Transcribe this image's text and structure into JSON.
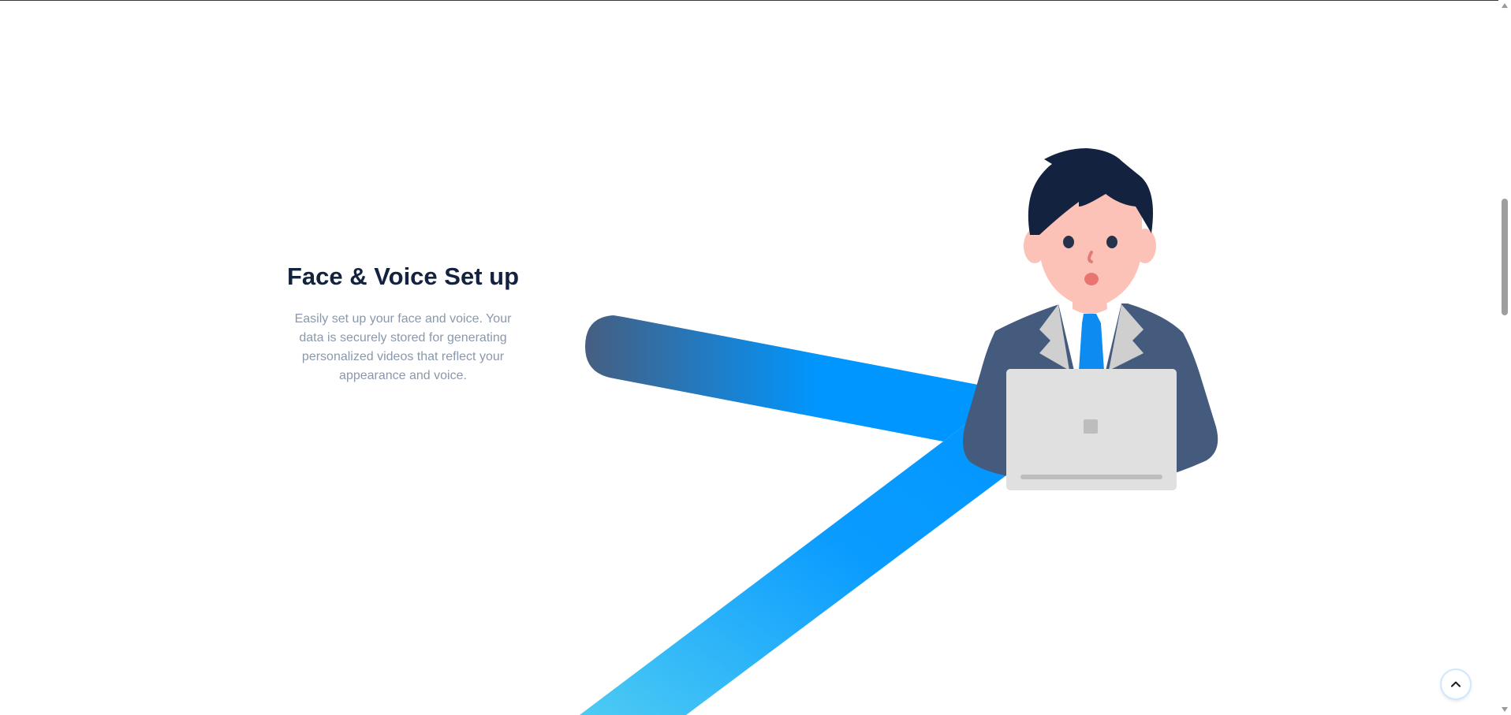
{
  "feature": {
    "title": "Face & Voice Set up",
    "description": "Easily set up your face and voice. Your data is securely stored for generating personalized videos that reflect your appearance and voice."
  },
  "illustration": {
    "icon": "person-with-laptop-illustration",
    "colors": {
      "hair": "#13233f",
      "skin": "#fcc2b8",
      "suit": "#445b7e",
      "lapel": "#cfcfcf",
      "tie": "#0d8bf0",
      "laptop": "#e0e0e0",
      "stripe_start": "#465e80",
      "stripe_mid": "#0096ff",
      "stripe_end": "#4dcbf3"
    }
  },
  "controls": {
    "back_to_top_icon": "chevron-up-icon"
  }
}
